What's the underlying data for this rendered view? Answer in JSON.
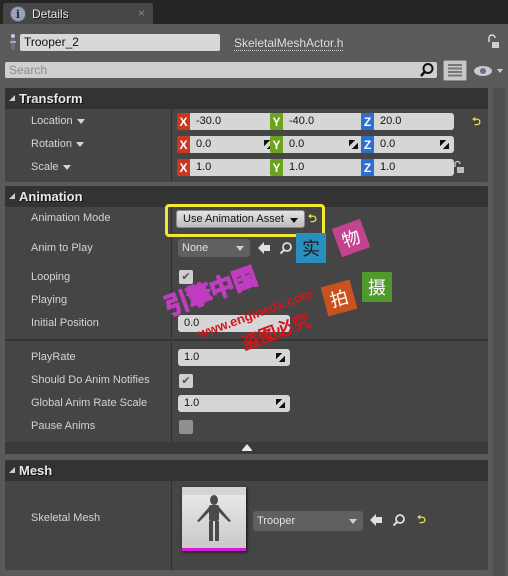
{
  "tab": {
    "icon": "info-icon",
    "title": "Details",
    "close": "×"
  },
  "header": {
    "actor_name": "Trooper_2",
    "class_link": "SkeletalMeshActor.h",
    "search_placeholder": "Search"
  },
  "transform": {
    "title": "Transform",
    "rows": [
      {
        "label": "Location",
        "x": "-30.0",
        "y": "-40.0",
        "z": "20.0"
      },
      {
        "label": "Rotation",
        "x": "0.0",
        "y": "0.0",
        "z": "0.0"
      },
      {
        "label": "Scale",
        "x": "1.0",
        "y": "1.0",
        "z": "1.0"
      }
    ],
    "axis_labels": {
      "x": "X",
      "y": "Y",
      "z": "Z"
    }
  },
  "animation": {
    "title": "Animation",
    "mode_label": "Animation Mode",
    "mode_value": "Use Animation Asset",
    "anim_to_play_label": "Anim to Play",
    "anim_to_play_value": "None",
    "looping_label": "Looping",
    "looping_checked": true,
    "playing_label": "Playing",
    "playing_checked": true,
    "initial_position_label": "Initial Position",
    "initial_position_value": "0.0",
    "playrate_label": "PlayRate",
    "playrate_value": "1.0",
    "notifies_label": "Should Do Anim Notifies",
    "notifies_checked": true,
    "global_rate_label": "Global Anim Rate Scale",
    "global_rate_value": "1.0",
    "pause_label": "Pause Anims",
    "pause_checked": false
  },
  "mesh": {
    "title": "Mesh",
    "skeletal_mesh_label": "Skeletal Mesh",
    "skeletal_mesh_value": "Trooper"
  },
  "watermark": {
    "site_cn": "引擎中国",
    "url": "www.enginedx.com",
    "notice": "盗图必究",
    "tiles": [
      "实",
      "物",
      "拍",
      "摄"
    ]
  },
  "colors": {
    "axis_x": "#c8391f",
    "axis_y": "#6ba31a",
    "axis_z": "#2c6fd0",
    "highlight": "#f2e830",
    "reset": "#e7e24a",
    "thumbnail_bar": "#d81ad8"
  }
}
